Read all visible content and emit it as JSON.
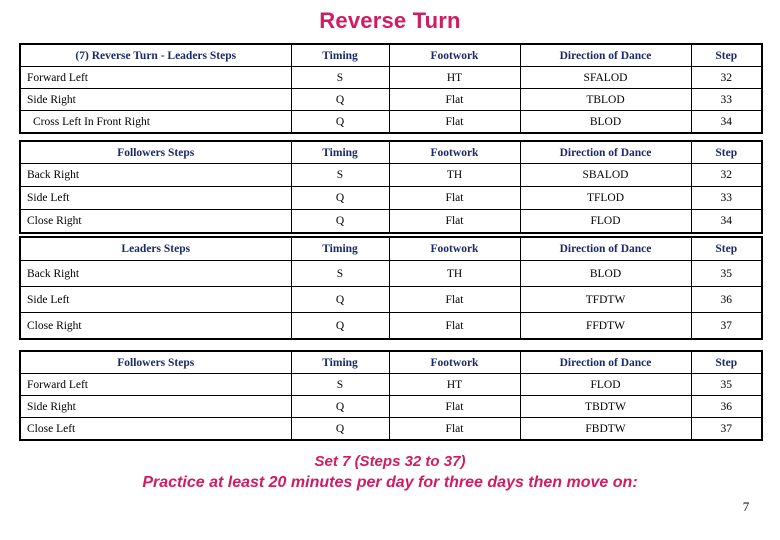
{
  "slide": {
    "title": "Reverse Turn",
    "page_number": "7",
    "title_color": "#d01c63",
    "header_color": "#1b2a6b",
    "body_color": "#000000"
  },
  "columns": [
    "Timing",
    "Footwork",
    "Direction of Dance",
    "Step"
  ],
  "tables": [
    {
      "id": "table-1",
      "headers": [
        "(7) Reverse Turn -  Leaders Steps",
        "Timing",
        "Footwork",
        "Direction of Dance",
        "Step"
      ],
      "rows": [
        {
          "name": "Forward Left",
          "timing": "S",
          "footwork": "HT",
          "direction": "SFALOD",
          "step": "32",
          "indented": false
        },
        {
          "name": "Side Right",
          "timing": "Q",
          "footwork": "Flat",
          "direction": "TBLOD",
          "step": "33",
          "indented": false
        },
        {
          "name": "Cross Left In Front Right",
          "timing": "Q",
          "footwork": "Flat",
          "direction": "BLOD",
          "step": "34",
          "indented": true
        }
      ]
    },
    {
      "id": "table-2",
      "headers": [
        "Followers Steps",
        "Timing",
        "Footwork",
        "Direction of Dance",
        "Step"
      ],
      "rows": [
        {
          "name": "Back Right",
          "timing": "S",
          "footwork": "TH",
          "direction": "SBALOD",
          "step": "32",
          "indented": false
        },
        {
          "name": "Side Left",
          "timing": "Q",
          "footwork": "Flat",
          "direction": "TFLOD",
          "step": "33",
          "indented": false
        },
        {
          "name": "Close Right",
          "timing": "Q",
          "footwork": "Flat",
          "direction": "FLOD",
          "step": "34",
          "indented": false
        }
      ]
    },
    {
      "id": "table-3",
      "headers": [
        "Leaders Steps",
        "Timing",
        "Footwork",
        "Direction of Dance",
        "Step"
      ],
      "rows": [
        {
          "name": "Back Right",
          "timing": "S",
          "footwork": "TH",
          "direction": "BLOD",
          "step": "35",
          "indented": false
        },
        {
          "name": "Side Left",
          "timing": "Q",
          "footwork": "Flat",
          "direction": "TFDTW",
          "step": "36",
          "indented": false
        },
        {
          "name": "Close Right",
          "timing": "Q",
          "footwork": "Flat",
          "direction": "FFDTW",
          "step": "37",
          "indented": false
        }
      ]
    },
    {
      "id": "table-4",
      "headers": [
        "Followers Steps",
        "Timing",
        "Footwork",
        "Direction of Dance",
        "Step"
      ],
      "rows": [
        {
          "name": "Forward Left",
          "timing": "S",
          "footwork": "HT",
          "direction": "FLOD",
          "step": "35",
          "indented": false
        },
        {
          "name": "Side Right",
          "timing": "Q",
          "footwork": "Flat",
          "direction": "TBDTW",
          "step": "36",
          "indented": false
        },
        {
          "name": "Close Left",
          "timing": "Q",
          "footwork": "Flat",
          "direction": "FBDTW",
          "step": "37",
          "indented": false
        }
      ]
    }
  ],
  "footer": {
    "line1": "Set 7 (Steps 32 to 37)",
    "line2": "Practice at least 20 minutes per day for three days then move on:"
  }
}
